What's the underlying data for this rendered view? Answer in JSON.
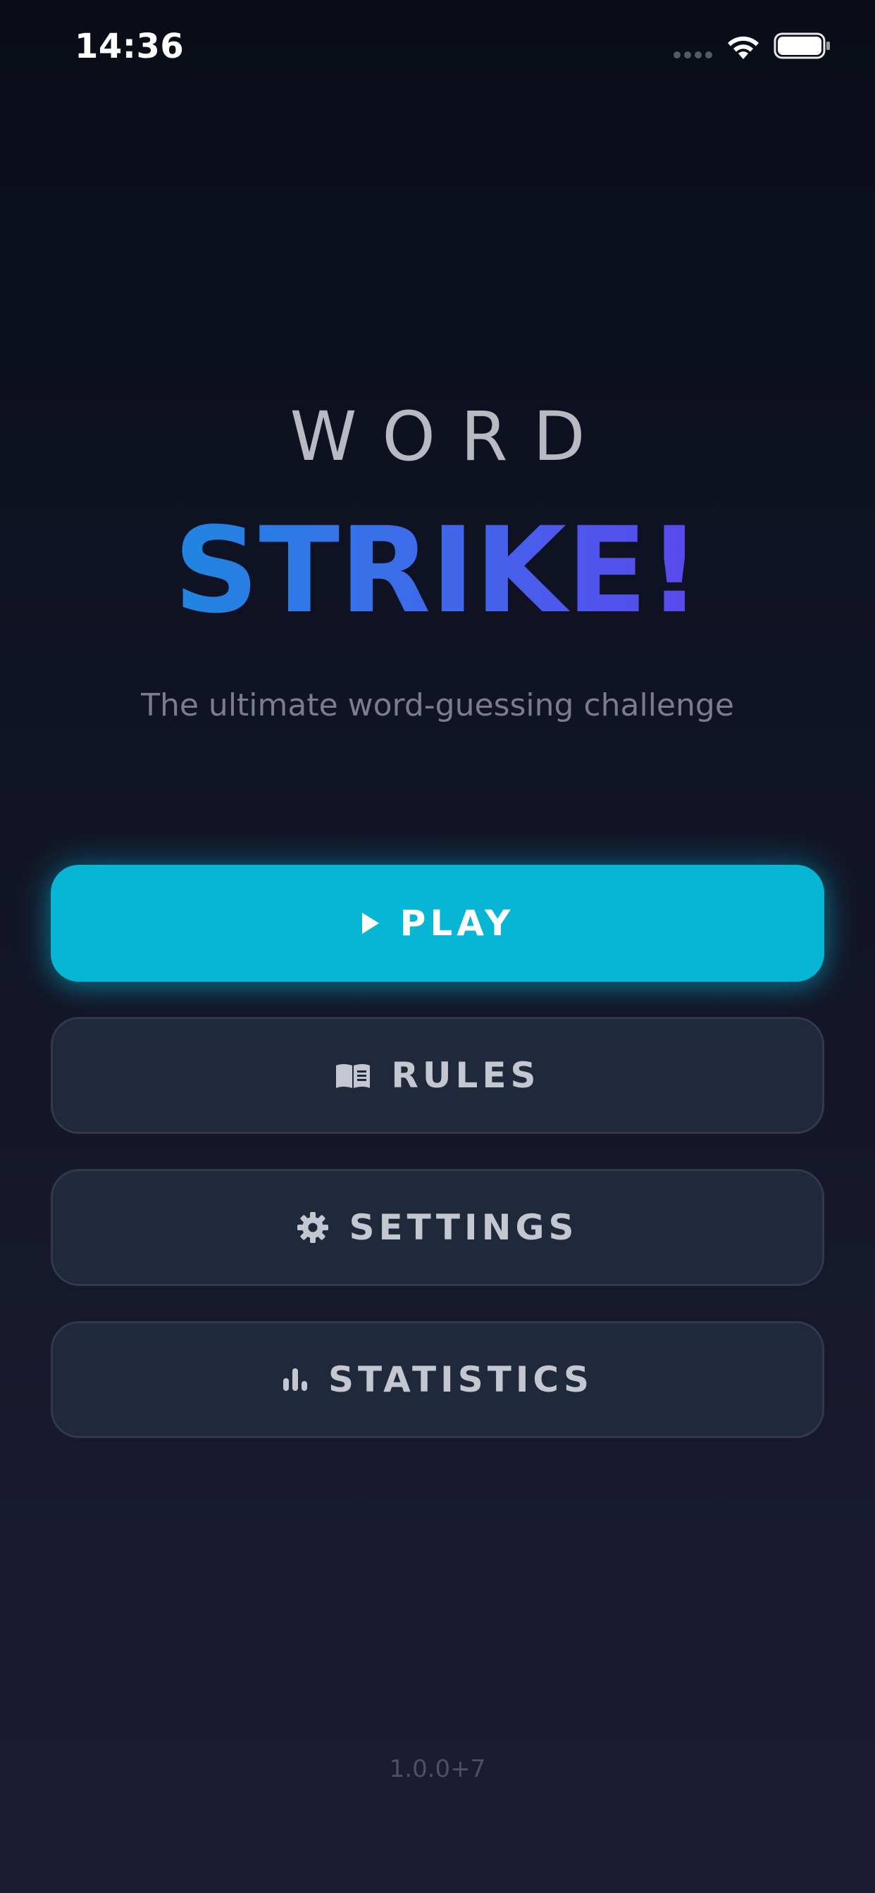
{
  "status_bar": {
    "time": "14:36",
    "icons": [
      "signal-dots-icon",
      "wifi-icon",
      "battery-icon"
    ]
  },
  "title": {
    "line1": "WORD",
    "line2": "STRIKE!"
  },
  "subtitle": "The ultimate word-guessing challenge",
  "menu": {
    "play": {
      "label": "PLAY",
      "icon": "play-icon"
    },
    "rules": {
      "label": "RULES",
      "icon": "book-icon"
    },
    "settings": {
      "label": "SETTINGS",
      "icon": "gear-icon"
    },
    "statistics": {
      "label": "STATISTICS",
      "icon": "bar-chart-icon"
    }
  },
  "version": "1.0.0+7",
  "colors": {
    "primary_button": "#06b6d4",
    "secondary_button": "#1f293b",
    "gradient_start": "#1f86e0",
    "gradient_end": "#5a48ec"
  }
}
